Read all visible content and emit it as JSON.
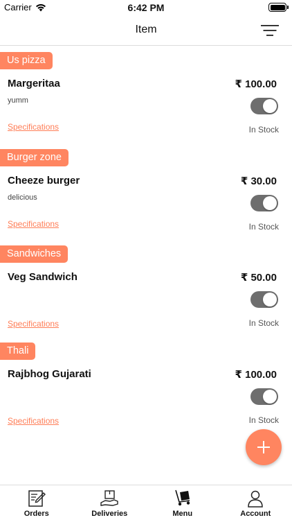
{
  "status_bar": {
    "carrier": "Carrier",
    "time": "6:42 PM"
  },
  "header": {
    "title": "Item",
    "filter_icon": "filter-lines-icon"
  },
  "stock_label": "In Stock",
  "specifications_label": "Specifications",
  "sections": [
    {
      "category": "Us pizza",
      "name": "Margeritaa",
      "price": "₹ 100.00",
      "description": "yumm",
      "in_stock": true
    },
    {
      "category": "Burger zone",
      "name": "Cheeze burger",
      "price": "₹ 30.00",
      "description": "delicious",
      "in_stock": true
    },
    {
      "category": "Sandwiches",
      "name": "Veg Sandwich",
      "price": "₹ 50.00",
      "description": "",
      "in_stock": true
    },
    {
      "category": "Thali",
      "name": "Rajbhog Gujarati",
      "price": "₹ 100.00",
      "description": "",
      "in_stock": true
    }
  ],
  "fab": {
    "icon": "plus-icon"
  },
  "tabs": [
    {
      "label": "Orders",
      "icon": "orders-icon"
    },
    {
      "label": "Deliveries",
      "icon": "deliveries-icon"
    },
    {
      "label": "Menu",
      "icon": "menu-trolley-icon"
    },
    {
      "label": "Account",
      "icon": "account-icon"
    }
  ],
  "colors": {
    "accent": "#ff8560",
    "toggle_on": "#6e6e6e",
    "link": "#ff7d56"
  }
}
